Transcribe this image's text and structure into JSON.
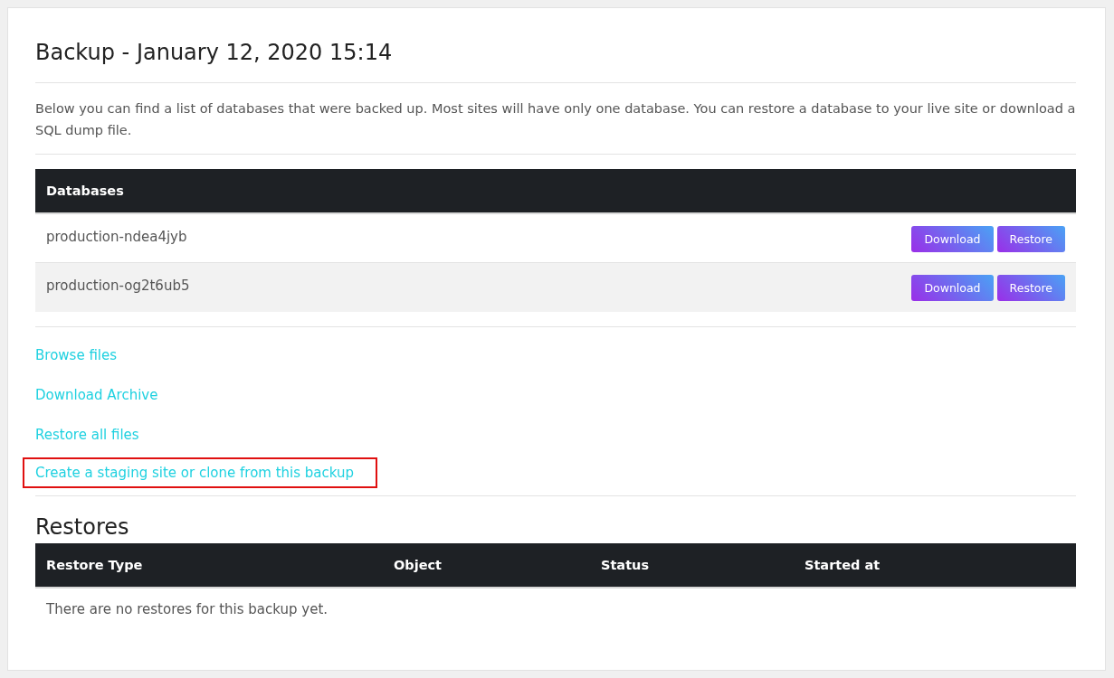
{
  "title": "Backup - January 12, 2020 15:14",
  "intro": "Below you can find a list of databases that were backed up. Most sites will have only one database. You can restore a database to your live site or download a SQL dump file.",
  "databases": {
    "heading": "Databases",
    "rows": [
      {
        "name": "production-ndea4jyb",
        "buttons": [
          "Download",
          "Restore"
        ]
      },
      {
        "name": "production-og2t6ub5",
        "buttons": [
          "Download",
          "Restore"
        ]
      }
    ]
  },
  "links": [
    {
      "label": "Browse files",
      "highlighted": false
    },
    {
      "label": "Download Archive",
      "highlighted": false
    },
    {
      "label": "Restore all files",
      "highlighted": false
    },
    {
      "label": "Create a staging site or clone from this backup",
      "highlighted": true
    }
  ],
  "restores": {
    "heading": "Restores",
    "columns": [
      "Restore Type",
      "Object",
      "Status",
      "Started at"
    ],
    "empty": "There are no restores for this backup yet."
  }
}
